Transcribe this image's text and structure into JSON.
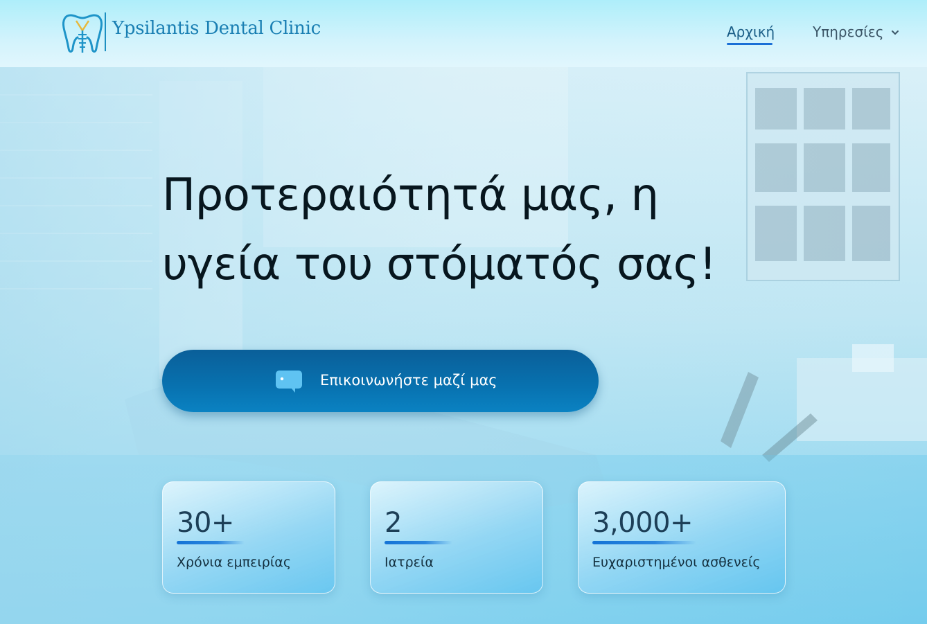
{
  "header": {
    "brand_name": "Ypsilantis Dental Clinic",
    "nav": {
      "home": "Αρχική",
      "services": "Υπηρεσίες"
    }
  },
  "hero": {
    "headline_line1": "Προτεραιότητά μας, η",
    "headline_line2": "υγεία του στόματός σας!",
    "cta_label": "Επικοινωνήστε μαζί μας"
  },
  "stats": [
    {
      "value": "30+",
      "label": "Χρόνια εμπειρίας"
    },
    {
      "value": "2",
      "label": "Ιατρεία"
    },
    {
      "value": "3,000+",
      "label": "Ευχαριστημένοι ασθενείς"
    }
  ],
  "icons": {
    "logo": "tooth-implant-logo-icon",
    "services_dropdown": "chevron-down-icon",
    "cta": "chat-bubble-icon"
  },
  "colors": {
    "brand": "#1a7fb3",
    "cta_background": "#0872b0",
    "active_nav_underline": "#1a6fd6",
    "headline_text": "#07161e"
  }
}
